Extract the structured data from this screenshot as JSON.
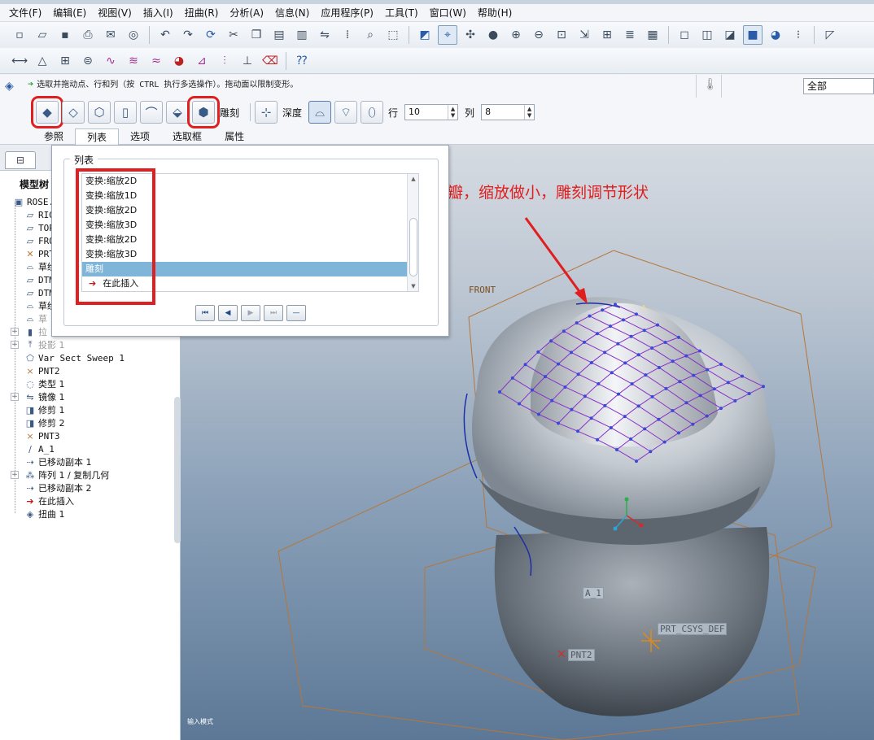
{
  "menubar": {
    "items": [
      "文件(F)",
      "编辑(E)",
      "视图(V)",
      "插入(I)",
      "扭曲(R)",
      "分析(A)",
      "信息(N)",
      "应用程序(P)",
      "工具(T)",
      "窗口(W)",
      "帮助(H)"
    ]
  },
  "dashboard": {
    "prompt": "选取并拖动点、行和列（按 CTRL 执行多选操作）。拖动面以限制变形。",
    "filter_value": "全部",
    "sculpt_label": "雕刻",
    "depth_label": "深度",
    "row_label": "行",
    "row_value": "10",
    "col_label": "列",
    "col_value": "8",
    "tabs": [
      "参照",
      "列表",
      "选项",
      "选取框",
      "属性"
    ],
    "active_tab": "列表"
  },
  "list_panel": {
    "legend": "列表",
    "items": [
      "变换:缩放2D",
      "变换:缩放1D",
      "变换:缩放2D",
      "变换:缩放3D",
      "变换:缩放2D",
      "变换:缩放3D",
      "雕刻",
      "在此插入"
    ],
    "selected_index": 6
  },
  "navigator": {
    "title": "模型树",
    "items": [
      {
        "label": "ROSE.P",
        "icon": "part-icon"
      },
      {
        "label": "RIG",
        "icon": "datum-plane-icon"
      },
      {
        "label": "TOP",
        "icon": "datum-plane-icon"
      },
      {
        "label": "FRO",
        "icon": "datum-plane-icon"
      },
      {
        "label": "PRT",
        "icon": "csys-icon"
      },
      {
        "label": "草绘",
        "icon": "sketch-icon"
      },
      {
        "label": "DTM",
        "icon": "datum-plane-icon"
      },
      {
        "label": "DTM",
        "icon": "datum-plane-icon"
      },
      {
        "label": "草绘",
        "icon": "sketch-icon"
      },
      {
        "label": "草",
        "icon": "sketch-icon"
      },
      {
        "label": "拉",
        "icon": "extrude-icon"
      },
      {
        "label": "投影 1",
        "icon": "projection-icon"
      },
      {
        "label": "Var Sect Sweep 1",
        "icon": "sweep-icon"
      },
      {
        "label": "PNT2",
        "icon": "point-icon"
      },
      {
        "label": "类型 1",
        "icon": "feature-icon"
      },
      {
        "label": "镜像 1",
        "icon": "mirror-icon"
      },
      {
        "label": "修剪 1",
        "icon": "trim-icon"
      },
      {
        "label": "修剪 2",
        "icon": "trim-icon"
      },
      {
        "label": "PNT3",
        "icon": "point-icon"
      },
      {
        "label": "A_1",
        "icon": "axis-icon"
      },
      {
        "label": "已移动副本 1",
        "icon": "move-copy-icon"
      },
      {
        "label": "阵列 1 / 复制几何",
        "icon": "pattern-icon"
      },
      {
        "label": "已移动副本 2",
        "icon": "move-copy-icon"
      },
      {
        "label": "在此插入",
        "icon": "insert-here-icon"
      },
      {
        "label": "扭曲 1",
        "icon": "warp-icon"
      }
    ]
  },
  "graphics": {
    "annotation": "将得出的第二层花瓣，缩放做小，雕刻调节形状",
    "labels": {
      "front": "FRONT",
      "csys": "PRT_CSYS_DEF",
      "axis": "A_1",
      "pnt": "PNT2",
      "a_mark": "A"
    },
    "status": "输入模式"
  },
  "colors": {
    "highlight": "#e02020",
    "selection": "#7fb5d8",
    "annotation": "#e01e1e",
    "datum": "#b5773a",
    "sculpt_grid": "#8a2ec8"
  }
}
